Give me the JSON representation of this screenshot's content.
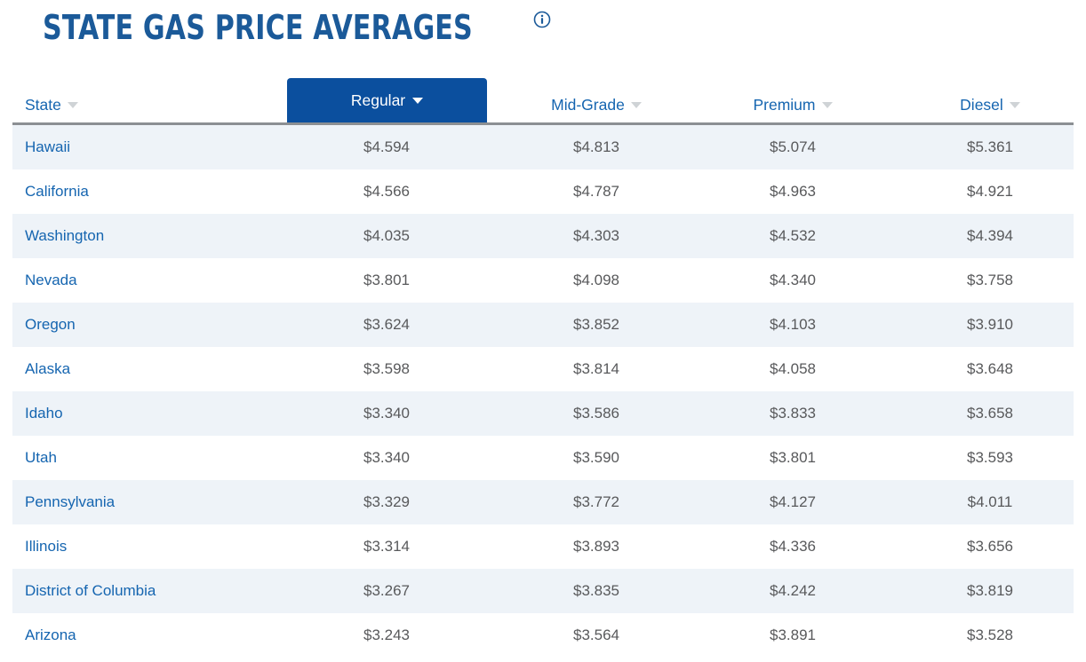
{
  "header": {
    "title": "STATE GAS PRICE AVERAGES",
    "info_icon": "info-circle-icon"
  },
  "table": {
    "columns": [
      {
        "key": "state",
        "label": "State",
        "caret": "chevron-down-icon",
        "active": false
      },
      {
        "key": "regular",
        "label": "Regular",
        "caret": "chevron-down-icon",
        "active": true
      },
      {
        "key": "midgrade",
        "label": "Mid-Grade",
        "caret": "chevron-down-icon",
        "active": false
      },
      {
        "key": "premium",
        "label": "Premium",
        "caret": "chevron-down-icon",
        "active": false
      },
      {
        "key": "diesel",
        "label": "Diesel",
        "caret": "chevron-down-icon",
        "active": false
      }
    ],
    "rows": [
      {
        "state": "Hawaii",
        "regular": "$4.594",
        "midgrade": "$4.813",
        "premium": "$5.074",
        "diesel": "$5.361"
      },
      {
        "state": "California",
        "regular": "$4.566",
        "midgrade": "$4.787",
        "premium": "$4.963",
        "diesel": "$4.921"
      },
      {
        "state": "Washington",
        "regular": "$4.035",
        "midgrade": "$4.303",
        "premium": "$4.532",
        "diesel": "$4.394"
      },
      {
        "state": "Nevada",
        "regular": "$3.801",
        "midgrade": "$4.098",
        "premium": "$4.340",
        "diesel": "$3.758"
      },
      {
        "state": "Oregon",
        "regular": "$3.624",
        "midgrade": "$3.852",
        "premium": "$4.103",
        "diesel": "$3.910"
      },
      {
        "state": "Alaska",
        "regular": "$3.598",
        "midgrade": "$3.814",
        "premium": "$4.058",
        "diesel": "$3.648"
      },
      {
        "state": "Idaho",
        "regular": "$3.340",
        "midgrade": "$3.586",
        "premium": "$3.833",
        "diesel": "$3.658"
      },
      {
        "state": "Utah",
        "regular": "$3.340",
        "midgrade": "$3.590",
        "premium": "$3.801",
        "diesel": "$3.593"
      },
      {
        "state": "Pennsylvania",
        "regular": "$3.329",
        "midgrade": "$3.772",
        "premium": "$4.127",
        "diesel": "$4.011"
      },
      {
        "state": "Illinois",
        "regular": "$3.314",
        "midgrade": "$3.893",
        "premium": "$4.336",
        "diesel": "$3.656"
      },
      {
        "state": "District of Columbia",
        "regular": "$3.267",
        "midgrade": "$3.835",
        "premium": "$4.242",
        "diesel": "$3.819"
      },
      {
        "state": "Arizona",
        "regular": "$3.243",
        "midgrade": "$3.564",
        "premium": "$3.891",
        "diesel": "$3.528"
      }
    ]
  },
  "colors": {
    "title_blue": "#1b5a99",
    "link_blue": "#1565b0",
    "active_tab_blue": "#0b4f9e",
    "stripe": "#eef3f8",
    "value_gray": "#58595b",
    "header_rule": "#8c8f93"
  }
}
